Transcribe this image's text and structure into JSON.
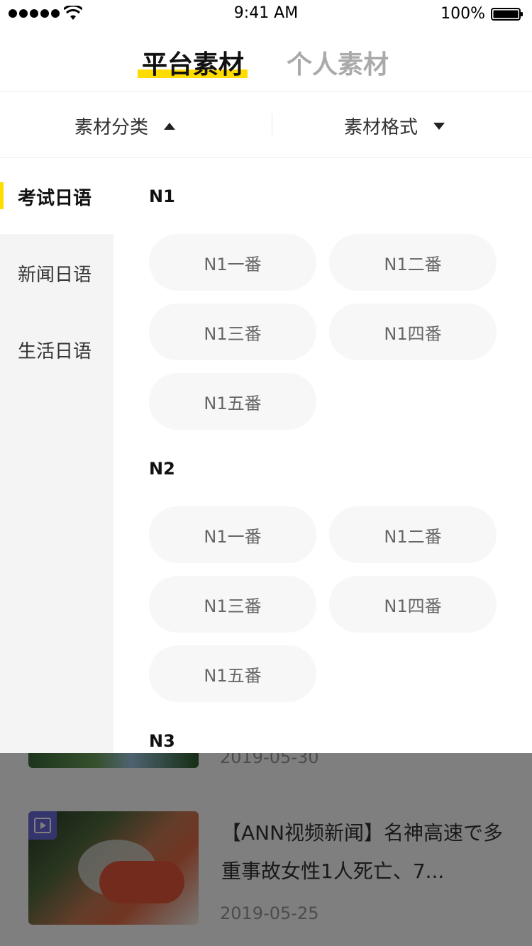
{
  "status_bar": {
    "time": "9:41 AM",
    "battery": "100%"
  },
  "tabs": [
    {
      "label": "平台素材",
      "active": true
    },
    {
      "label": "个人素材",
      "active": false
    }
  ],
  "filters": {
    "category_label": "素材分类",
    "format_label": "素材格式"
  },
  "sidebar": {
    "items": [
      {
        "label": "考试日语",
        "active": true
      },
      {
        "label": "新闻日语",
        "active": false
      },
      {
        "label": "生活日语",
        "active": false
      }
    ]
  },
  "sections": [
    {
      "title": "N1",
      "chips": [
        "N1一番",
        "N1二番",
        "N1三番",
        "N1四番",
        "N1五番"
      ]
    },
    {
      "title": "N2",
      "chips": [
        "N1一番",
        "N1二番",
        "N1三番",
        "N1四番",
        "N1五番"
      ]
    },
    {
      "title": "N3",
      "chips": []
    }
  ],
  "background_list": {
    "items": [
      {
        "title": "",
        "date": "2019-05-30"
      },
      {
        "title": "【ANN视频新闻】名神高速で多重事故女性1人死亡、7...",
        "date": "2019-05-25"
      }
    ]
  },
  "colors": {
    "accent": "#ffdc00",
    "overlay": "rgba(0,0,0,0.5)"
  }
}
